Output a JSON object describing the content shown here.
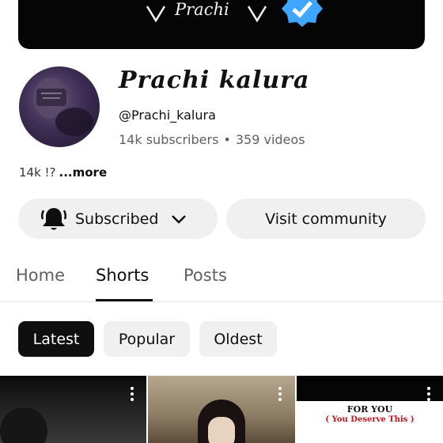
{
  "banner": {
    "text": "Prachi",
    "verified_icon": "verified-badge-icon",
    "heart_icon": "heart-outline-icon"
  },
  "channel": {
    "name": "Prachi kalura",
    "handle": "@Prachi_kalura",
    "subscribers": "14k subscribers",
    "separator": "•",
    "videos": "359 videos",
    "description": "14k !?",
    "more_label": "...more"
  },
  "buttons": {
    "subscribed_label": "Subscribed",
    "bell_icon": "bell-icon",
    "chevron_icon": "chevron-down-icon",
    "visit_community_label": "Visit community"
  },
  "tabs": [
    {
      "label": "Home"
    },
    {
      "label": "Shorts",
      "active": true
    },
    {
      "label": "Posts"
    }
  ],
  "chips": [
    {
      "label": "Latest",
      "selected": true
    },
    {
      "label": "Popular"
    },
    {
      "label": "Oldest"
    }
  ],
  "shorts": [
    {
      "menu_icon": "more-vert-icon"
    },
    {
      "menu_icon": "more-vert-icon"
    },
    {
      "menu_icon": "more-vert-icon",
      "title": "FOR YOU",
      "subtitle": "( You Deserve This )"
    }
  ],
  "colors": {
    "accent_blue": "#3ea6ff",
    "chip_selected_bg": "#0f0f0f",
    "chip_bg": "#f0f0f0",
    "subtitle_red": "#c0141c"
  }
}
